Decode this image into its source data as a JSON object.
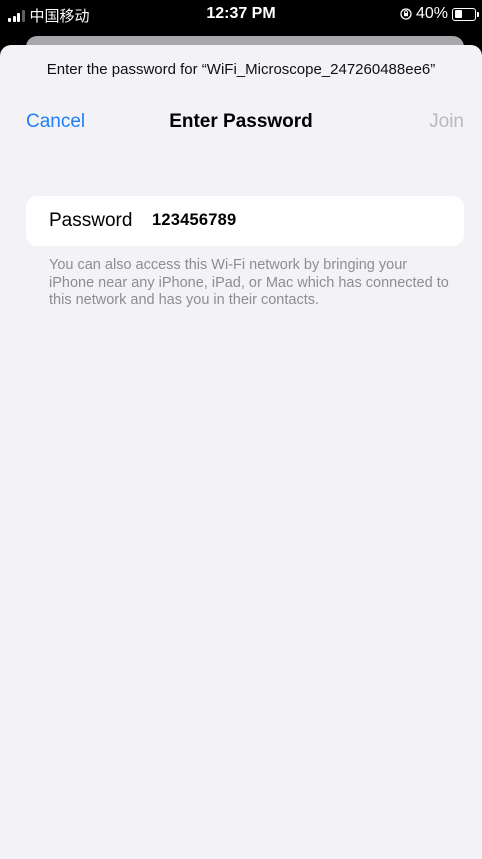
{
  "status_bar": {
    "carrier": "中国移动",
    "time": "12:37 PM",
    "battery_percent": "40%",
    "battery_level": 0.4,
    "icons": [
      "signal-icon",
      "orientation-lock-icon",
      "battery-icon"
    ]
  },
  "sheet": {
    "prompt": "Enter the password for “WiFi_Microscope_247260488ee6”",
    "nav": {
      "cancel": "Cancel",
      "title": "Enter Password",
      "join": "Join"
    },
    "password_field": {
      "label": "Password",
      "value": "123456789"
    },
    "footnote": "You can also access this Wi-Fi network by bringing your iPhone near any iPhone, iPad, or Mac which has connected to this network and has you in their contacts."
  },
  "colors": {
    "accent": "#1f7ff5",
    "disabled": "#b9b9be",
    "background": "#f2f2f7",
    "secondary_text": "#8d8d92"
  }
}
